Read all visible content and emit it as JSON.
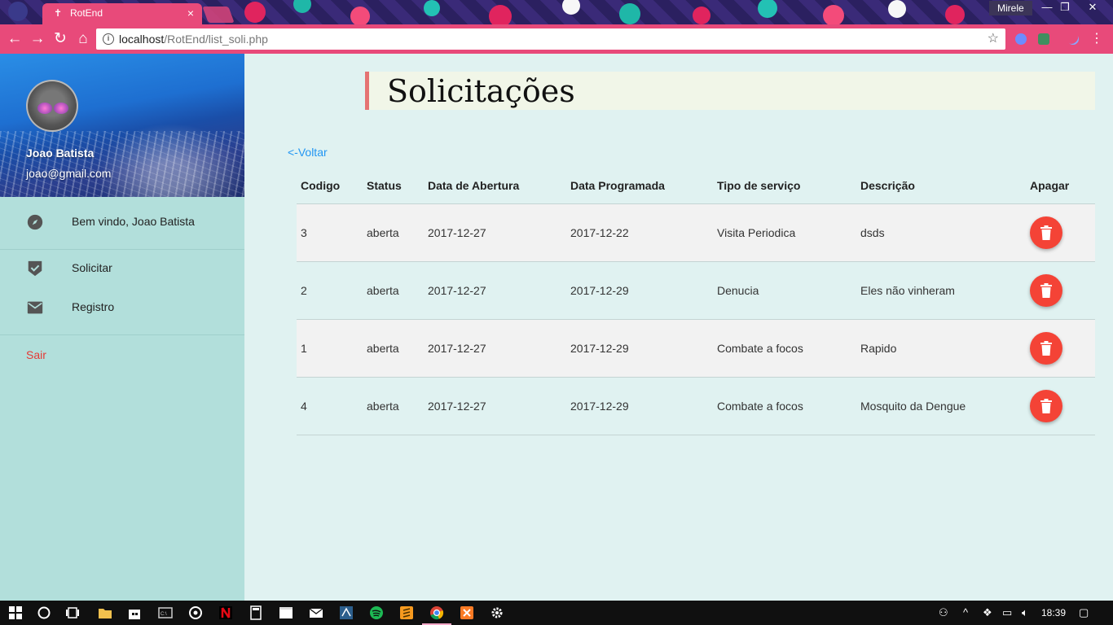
{
  "browser": {
    "tab_title": "RotEnd",
    "tab_close": "×",
    "url_host": "localhost",
    "url_path": "/RotEnd/list_soli.php",
    "profile_user": "Mirele",
    "win_minimize": "—",
    "win_restore": "❐",
    "win_close": "✕",
    "back_icon": "arrow-left-icon",
    "forward_icon": "arrow-right-icon",
    "reload_icon": "reload-icon",
    "home_icon": "home-icon",
    "back_glyph": "←",
    "forward_glyph": "→",
    "reload_glyph": "↻",
    "home_glyph": "⌂",
    "info_glyph": "i",
    "star_glyph": "☆",
    "accent": "#e84a7a"
  },
  "sidebar": {
    "user_name": "Joao Batista",
    "user_email": "joao@gmail.com",
    "items": [
      {
        "label": "Bem vindo, Joao Batista",
        "icon": "compass-icon"
      },
      {
        "label": "Solicitar",
        "icon": "verified-shield-icon"
      },
      {
        "label": "Registro",
        "icon": "mail-icon"
      }
    ],
    "logout_label": "Sair",
    "logout_color": "#e53935"
  },
  "main": {
    "title": "Solicitações",
    "back_link": "<-Voltar",
    "table": {
      "headers": [
        "Codigo",
        "Status",
        "Data de Abertura",
        "Data Programada",
        "Tipo de serviço",
        "Descrição",
        "Apagar"
      ],
      "rows": [
        {
          "codigo": "3",
          "status": "aberta",
          "abertura": "2017-12-27",
          "programada": "2017-12-22",
          "tipo": "Visita Periodica",
          "descricao": "dsds"
        },
        {
          "codigo": "2",
          "status": "aberta",
          "abertura": "2017-12-27",
          "programada": "2017-12-29",
          "tipo": "Denucia",
          "descricao": "Eles não vinheram"
        },
        {
          "codigo": "1",
          "status": "aberta",
          "abertura": "2017-12-27",
          "programada": "2017-12-29",
          "tipo": "Combate a focos",
          "descricao": "Rapido"
        },
        {
          "codigo": "4",
          "status": "aberta",
          "abertura": "2017-12-27",
          "programada": "2017-12-29",
          "tipo": "Combate a focos",
          "descricao": "Mosquito da Dengue"
        }
      ],
      "delete_icon": "trash-icon",
      "delete_color": "#f44336"
    }
  },
  "taskbar": {
    "clock": "18:39",
    "apps": [
      "windows-start-icon",
      "cortana-icon",
      "task-view-icon",
      "file-explorer-icon",
      "store-icon",
      "terminal-icon",
      "media-icon",
      "netflix-icon",
      "calculator-icon",
      "video-editor-icon",
      "mail-icon",
      "ide-icon",
      "spotify-icon",
      "sublime-icon",
      "chrome-icon",
      "xampp-icon",
      "settings-icon"
    ]
  }
}
